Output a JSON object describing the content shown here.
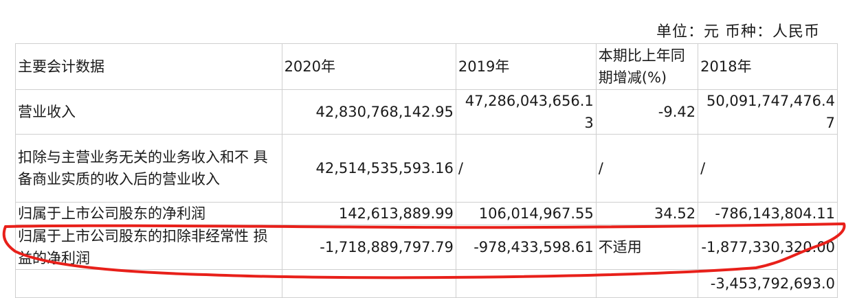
{
  "unit_line": "单位：元 币种：人民币",
  "headers": [
    "主要会计数据",
    "2020年",
    "2019年",
    "本期比上年同期增减(%)",
    "2018年"
  ],
  "rows": [
    [
      "营业收入",
      "42,830,768,142.95",
      "47,286,043,656.13",
      "-9.42",
      "50,091,747,476.47"
    ],
    [
      "扣除与主营业务无关的业务收入和不 具备商业实质的收入后的营业收入",
      "42,514,535,593.16",
      "/",
      "/",
      "/"
    ],
    [
      "归属于上市公司股东的净利润",
      "142,613,889.99",
      "106,014,967.55",
      "34.52",
      "-786,143,804.11"
    ],
    [
      "归属于上市公司股东的扣除非经常性 损益的净利润",
      "-1,718,889,797.79",
      "-978,433,598.61",
      "不适用",
      "-1,877,330,320.00"
    ],
    [
      "",
      "",
      "",
      "",
      "-3,453,792,693.0"
    ]
  ],
  "annotation_color": "#e8201a"
}
